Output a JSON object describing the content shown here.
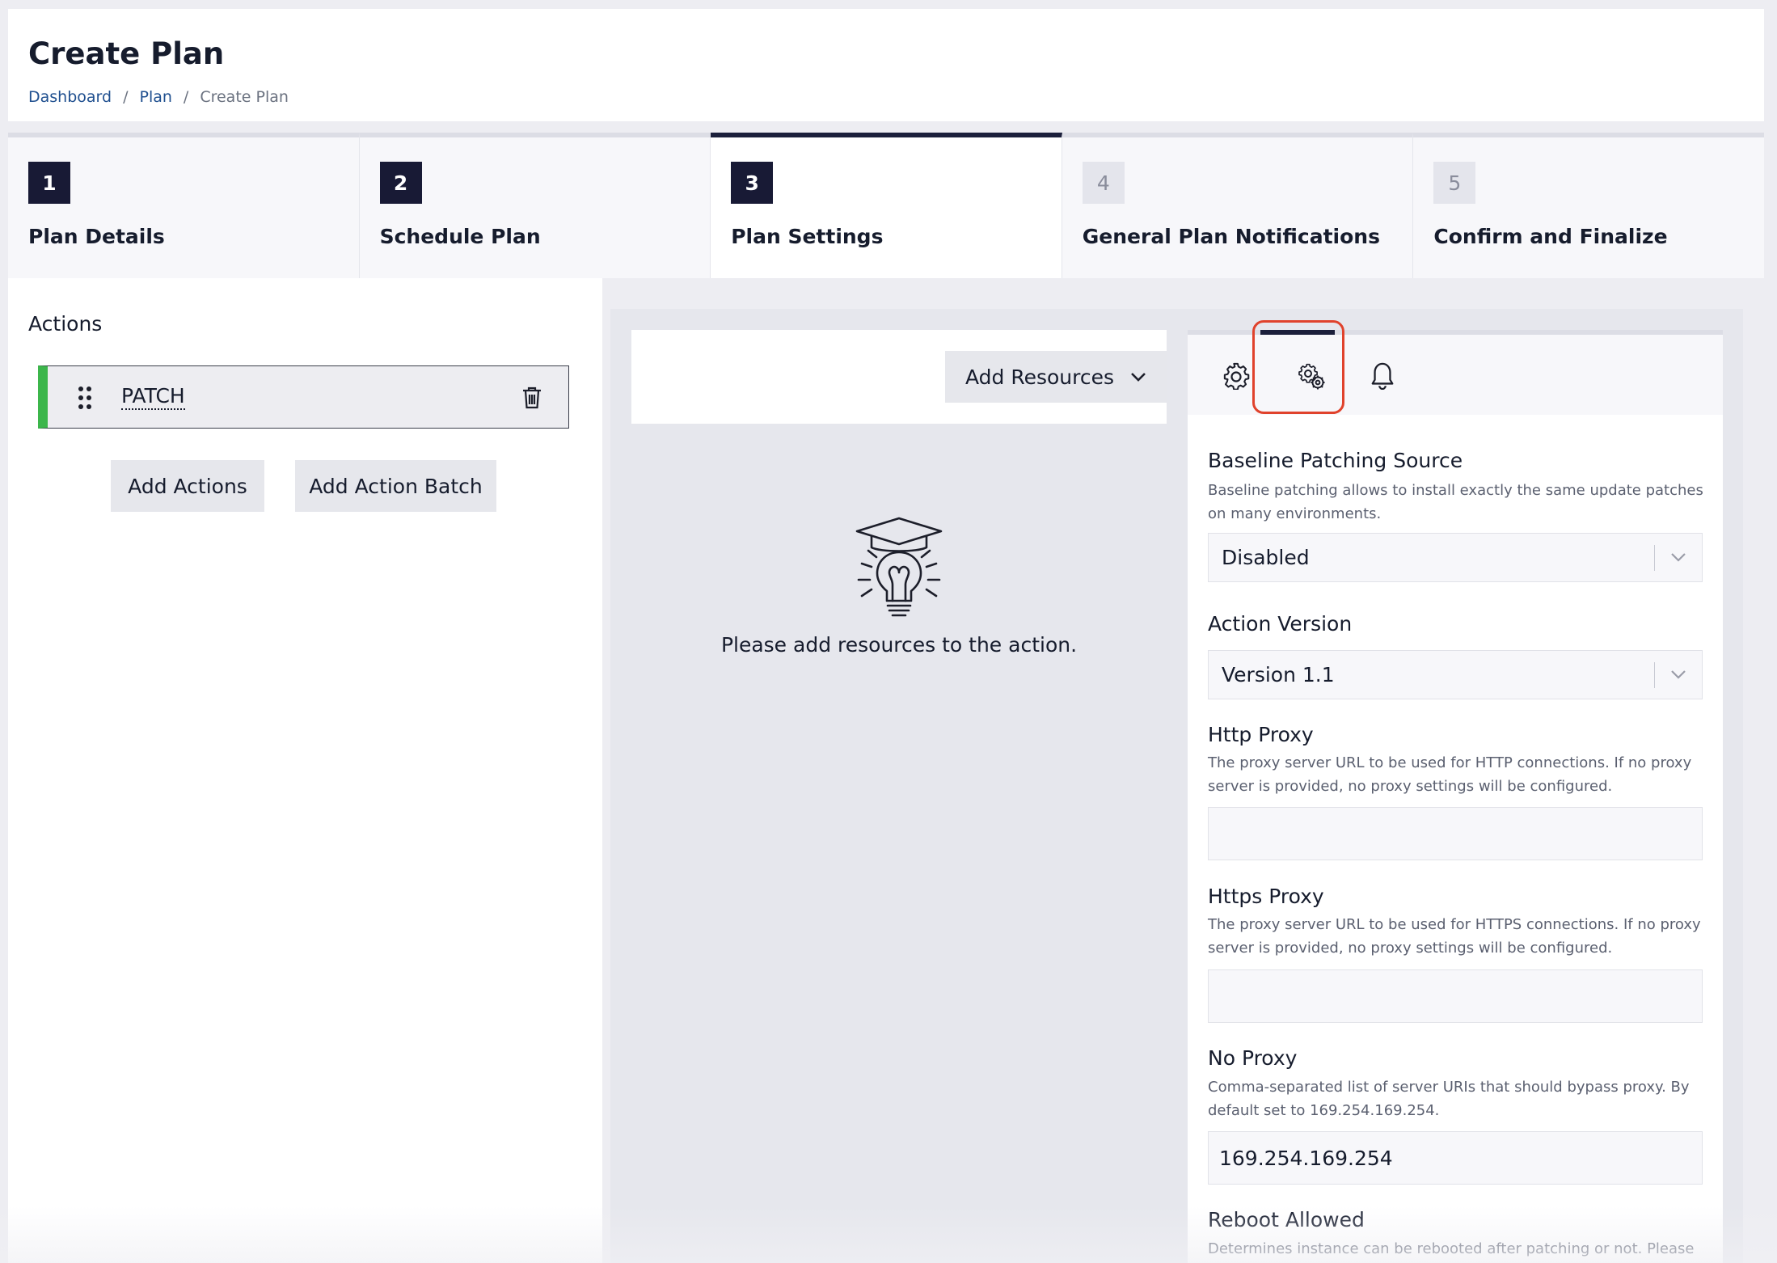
{
  "header": {
    "title": "Create Plan",
    "breadcrumb": [
      {
        "label": "Dashboard"
      },
      {
        "label": "Plan"
      },
      {
        "label": "Create Plan"
      }
    ],
    "separator": "/"
  },
  "stepper": {
    "steps": [
      {
        "number": "1",
        "label": "Plan Details",
        "status": "complete"
      },
      {
        "number": "2",
        "label": "Schedule Plan",
        "status": "complete"
      },
      {
        "number": "3",
        "label": "Plan Settings",
        "status": "active"
      },
      {
        "number": "4",
        "label": "General Plan Notifications",
        "status": "pending"
      },
      {
        "number": "5",
        "label": "Confirm and Finalize",
        "status": "pending"
      }
    ]
  },
  "actions": {
    "title": "Actions",
    "items": [
      {
        "name": "PATCH",
        "accent_color": "#3cb64b"
      }
    ],
    "add_actions_label": "Add Actions",
    "add_action_batch_label": "Add Action Batch"
  },
  "resources": {
    "add_resources_label": "Add Resources",
    "empty_icon": "lightbulb-graduation-icon",
    "empty_text": "Please add resources to the action."
  },
  "settings": {
    "tabs": [
      {
        "icon": "gear-icon",
        "active": false
      },
      {
        "icon": "advanced-settings-icon",
        "active": true
      },
      {
        "icon": "bell-icon",
        "active": false
      }
    ],
    "highlight_color": "#e0422c",
    "fields": {
      "baseline": {
        "label": "Baseline Patching Source",
        "description": "Baseline patching allows to install exactly the same update patches on many environments.",
        "value": "Disabled"
      },
      "action_version": {
        "label": "Action Version",
        "value": "Version 1.1"
      },
      "http_proxy": {
        "label": "Http Proxy",
        "description": "The proxy server URL to be used for HTTP connections. If no proxy server is provided, no proxy settings will be configured.",
        "value": ""
      },
      "https_proxy": {
        "label": "Https Proxy",
        "description": "The proxy server URL to be used for HTTPS connections. If no proxy server is provided, no proxy settings will be configured.",
        "value": ""
      },
      "no_proxy": {
        "label": "No Proxy",
        "description": "Comma-separated list of server URIs that should bypass proxy. By default set to 169.254.169.254.",
        "value": "169.254.169.254"
      },
      "reboot": {
        "label": "Reboot Allowed",
        "description": "Determines instance can be rebooted after patching or not. Please"
      }
    }
  }
}
